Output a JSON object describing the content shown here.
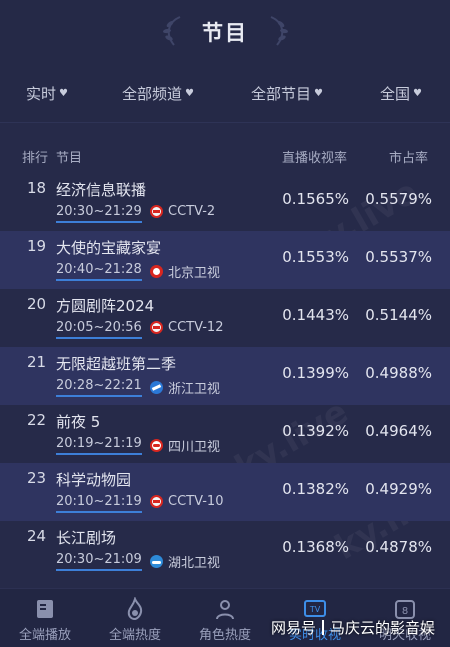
{
  "header": {
    "title": "节目"
  },
  "filters": [
    {
      "label": "实时"
    },
    {
      "label": "全部频道"
    },
    {
      "label": "全部节目"
    },
    {
      "label": "全国"
    }
  ],
  "columns": {
    "rank": "排行",
    "program": "节目",
    "rating": "直播收视率",
    "share": "市占率"
  },
  "rows": [
    {
      "rank": "18",
      "name": "经济信息联播",
      "time": "20:30~21:29",
      "channel": "CCTV-2",
      "logo": "cctv-logo",
      "rating": "0.1565%",
      "share": "0.5579%"
    },
    {
      "rank": "19",
      "name": "大使的宝藏家宴",
      "time": "20:40~21:28",
      "channel": "北京卫视",
      "logo": "beijing-tv-logo",
      "rating": "0.1553%",
      "share": "0.5537%"
    },
    {
      "rank": "20",
      "name": "方圆剧阵2024",
      "time": "20:05~20:56",
      "channel": "CCTV-12",
      "logo": "cctv-logo",
      "rating": "0.1443%",
      "share": "0.5144%"
    },
    {
      "rank": "21",
      "name": "无限超越班第二季",
      "time": "20:28~22:21",
      "channel": "浙江卫视",
      "logo": "zhejiang-tv-logo",
      "rating": "0.1399%",
      "share": "0.4988%"
    },
    {
      "rank": "22",
      "name": "前夜 5",
      "time": "20:19~21:19",
      "channel": "四川卫视",
      "logo": "sichuan-tv-logo",
      "rating": "0.1392%",
      "share": "0.4964%"
    },
    {
      "rank": "23",
      "name": "科学动物园",
      "time": "20:10~21:19",
      "channel": "CCTV-10",
      "logo": "cctv-logo",
      "rating": "0.1382%",
      "share": "0.4929%"
    },
    {
      "rank": "24",
      "name": "长江剧场",
      "time": "20:30~21:09",
      "channel": "湖北卫视",
      "logo": "hubei-tv-logo",
      "rating": "0.1368%",
      "share": "0.4878%"
    }
  ],
  "tabs": [
    {
      "label": "全端播放",
      "icon": "book-icon"
    },
    {
      "label": "全端热度",
      "icon": "flame-icon"
    },
    {
      "label": "角色热度",
      "icon": "person-icon"
    },
    {
      "label": "实时收视",
      "icon": "tv-icon"
    },
    {
      "label": "明天收视",
      "icon": "calendar-icon"
    }
  ],
  "credit": {
    "platform": "网易号",
    "author": "马庆云的影音娱"
  },
  "colors": {
    "background": "#262a49",
    "accent": "#3d8ee8",
    "row_alt": "#2f3460"
  }
}
